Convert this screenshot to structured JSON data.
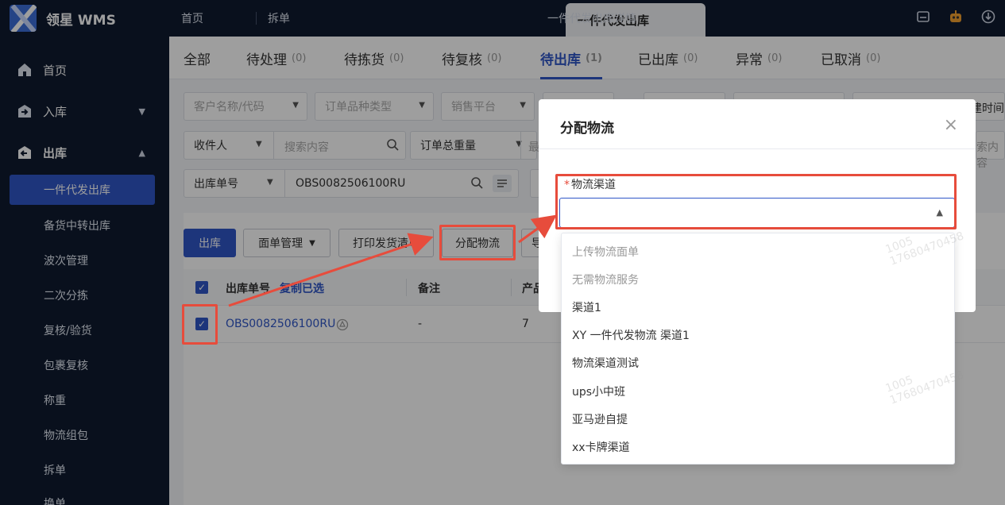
{
  "brand": {
    "name": "领星 WMS"
  },
  "sidebar": {
    "items": [
      {
        "label": "首页"
      },
      {
        "label": "入库"
      },
      {
        "label": "出库"
      }
    ],
    "sub_items": [
      {
        "label": "一件代发出库"
      },
      {
        "label": "备货中转出库"
      },
      {
        "label": "波次管理"
      },
      {
        "label": "二次分拣"
      },
      {
        "label": "复核/验货"
      },
      {
        "label": "包裹复核"
      },
      {
        "label": "称重"
      },
      {
        "label": "物流组包"
      },
      {
        "label": "拆单"
      },
      {
        "label": "换单"
      }
    ]
  },
  "top_tabs": [
    {
      "label": "首页"
    },
    {
      "label": "拆单"
    },
    {
      "label": "一件代发出库"
    },
    {
      "label": "一件代发出库详情"
    }
  ],
  "status_tabs": [
    {
      "label": "全部",
      "count": ""
    },
    {
      "label": "待处理",
      "count": "(0)"
    },
    {
      "label": "待拣货",
      "count": "(0)"
    },
    {
      "label": "待复核",
      "count": "(0)"
    },
    {
      "label": "待出库",
      "count": "(1)"
    },
    {
      "label": "已出库",
      "count": "(0)"
    },
    {
      "label": "异常",
      "count": "(0)"
    },
    {
      "label": "已取消",
      "count": "(0)"
    }
  ],
  "filters": {
    "customer": "客户名称/代码",
    "order_type": "订单品种类型",
    "platform": "销售平台",
    "receiver": "收件人",
    "search_placeholder": "搜索内容",
    "weight": "订单总重量",
    "weight_partial": "最",
    "order_no_label": "出库单号",
    "order_no_value": "OBS0082506100RU",
    "created_partial": "创建时间",
    "search_partial": "索内容"
  },
  "actions": {
    "outbound": "出库",
    "waybill": "面单管理",
    "print": "打印发货清单",
    "assign": "分配物流",
    "more_partial": "导"
  },
  "table": {
    "headers": {
      "order_no": "出库单号",
      "copy": "复制已选",
      "remark": "备注",
      "product": "产品"
    },
    "rows": [
      {
        "order_no": "OBS0082506100RU",
        "remark": "-",
        "product": "7"
      }
    ]
  },
  "dialog": {
    "title": "分配物流",
    "close": "×",
    "field_label": "物流渠道",
    "required_mark": "*",
    "options": [
      {
        "label": "上传物流面单",
        "disabled": true
      },
      {
        "label": "无需物流服务",
        "disabled": true
      },
      {
        "label": "渠道1",
        "disabled": false
      },
      {
        "label": "XY 一件代发物流 渠道1",
        "disabled": false
      },
      {
        "label": "物流渠道测试",
        "disabled": false
      },
      {
        "label": "ups小中班",
        "disabled": false
      },
      {
        "label": "亚马逊自提",
        "disabled": false
      },
      {
        "label": "xx卡牌渠道",
        "disabled": false
      }
    ]
  },
  "watermark": {
    "line1": "1005",
    "line2": "17680470458"
  },
  "colors": {
    "primary": "#2f56c7",
    "sidebar": "#0f1b30",
    "highlight": "#e74c3c"
  }
}
